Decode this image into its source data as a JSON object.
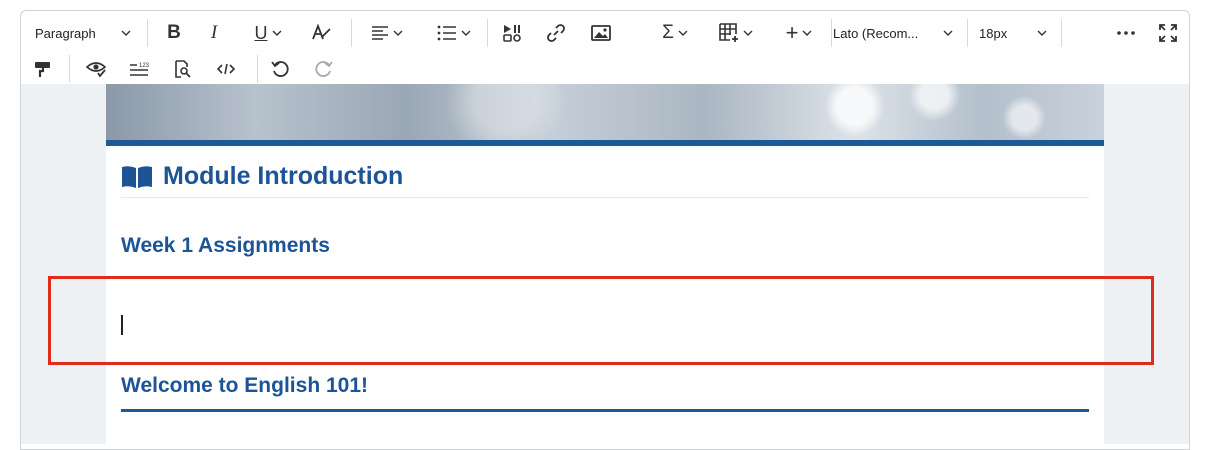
{
  "toolbar": {
    "paragraph_format": "Paragraph",
    "font_family": "Lato (Recom...",
    "font_size": "18px",
    "buttons": {
      "bold": "bold-icon",
      "italic": "italic-icon",
      "underline": "underline-icon",
      "format_clear": "text-style-icon",
      "align": "align-left-icon",
      "list": "bullet-list-icon",
      "media": "media-icon",
      "link": "link-icon",
      "image": "image-icon",
      "equation": "sigma-icon",
      "table": "table-icon",
      "insert": "plus-icon",
      "more": "more-icon",
      "fullscreen": "fullscreen-icon",
      "format_painter": "paint-roller-icon",
      "accessibility": "accessibility-checker-icon",
      "word_count": "word-count-icon",
      "preview": "preview-icon",
      "source_code": "source-code-icon",
      "undo": "undo-icon",
      "redo": "redo-icon"
    }
  },
  "content": {
    "module_heading": "Module Introduction",
    "week_heading": "Week 1 Assignments",
    "welcome_heading": "Welcome to English 101!"
  },
  "colors": {
    "heading": "#1c5496",
    "highlight_box": "#e02a1a",
    "banner_bar": "#1b5a96"
  }
}
